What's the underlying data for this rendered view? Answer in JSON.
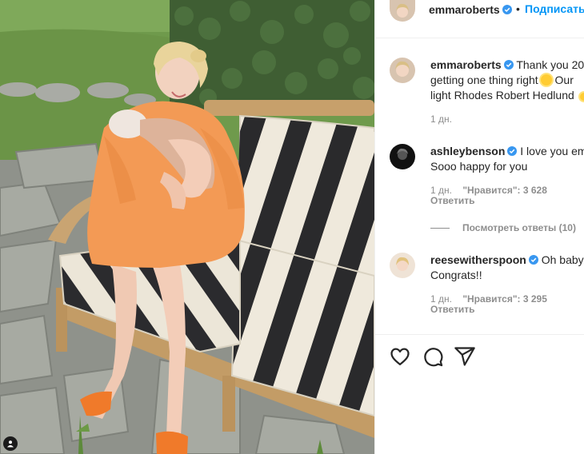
{
  "post": {
    "image_alt": "Photo",
    "tag_icon": "user-tag-icon"
  },
  "header": {
    "username": "emmaroberts",
    "separator": "•",
    "follow_label": "Подписаться"
  },
  "caption": {
    "username": "emmaroberts",
    "line1": "Thank you 20",
    "line2": "getting one thing right",
    "line2_suffix": "Our",
    "line3": "light Rhodes Robert Hedlund",
    "time": "1 дн."
  },
  "comments": [
    {
      "username": "ashleybenson",
      "line1": "I love you em",
      "line2": "Sooo happy for you",
      "time": "1 дн.",
      "likes": "\"Нравится\": 3 628",
      "reply": "Ответить",
      "view_replies": "Посмотреть ответы (10)"
    },
    {
      "username": "reesewitherspoon",
      "line1": "Oh baby!",
      "line2": "Congrats!!",
      "time": "1 дн.",
      "likes": "\"Нравится\": 3 295",
      "reply": "Ответить"
    }
  ],
  "actions": {
    "like_icon": "heart-icon",
    "comment_icon": "comment-icon",
    "share_icon": "share-icon"
  },
  "colors": {
    "accent": "#0095f6",
    "verified": "#3897f0",
    "muted": "#8e8e8e",
    "text": "#262626"
  }
}
